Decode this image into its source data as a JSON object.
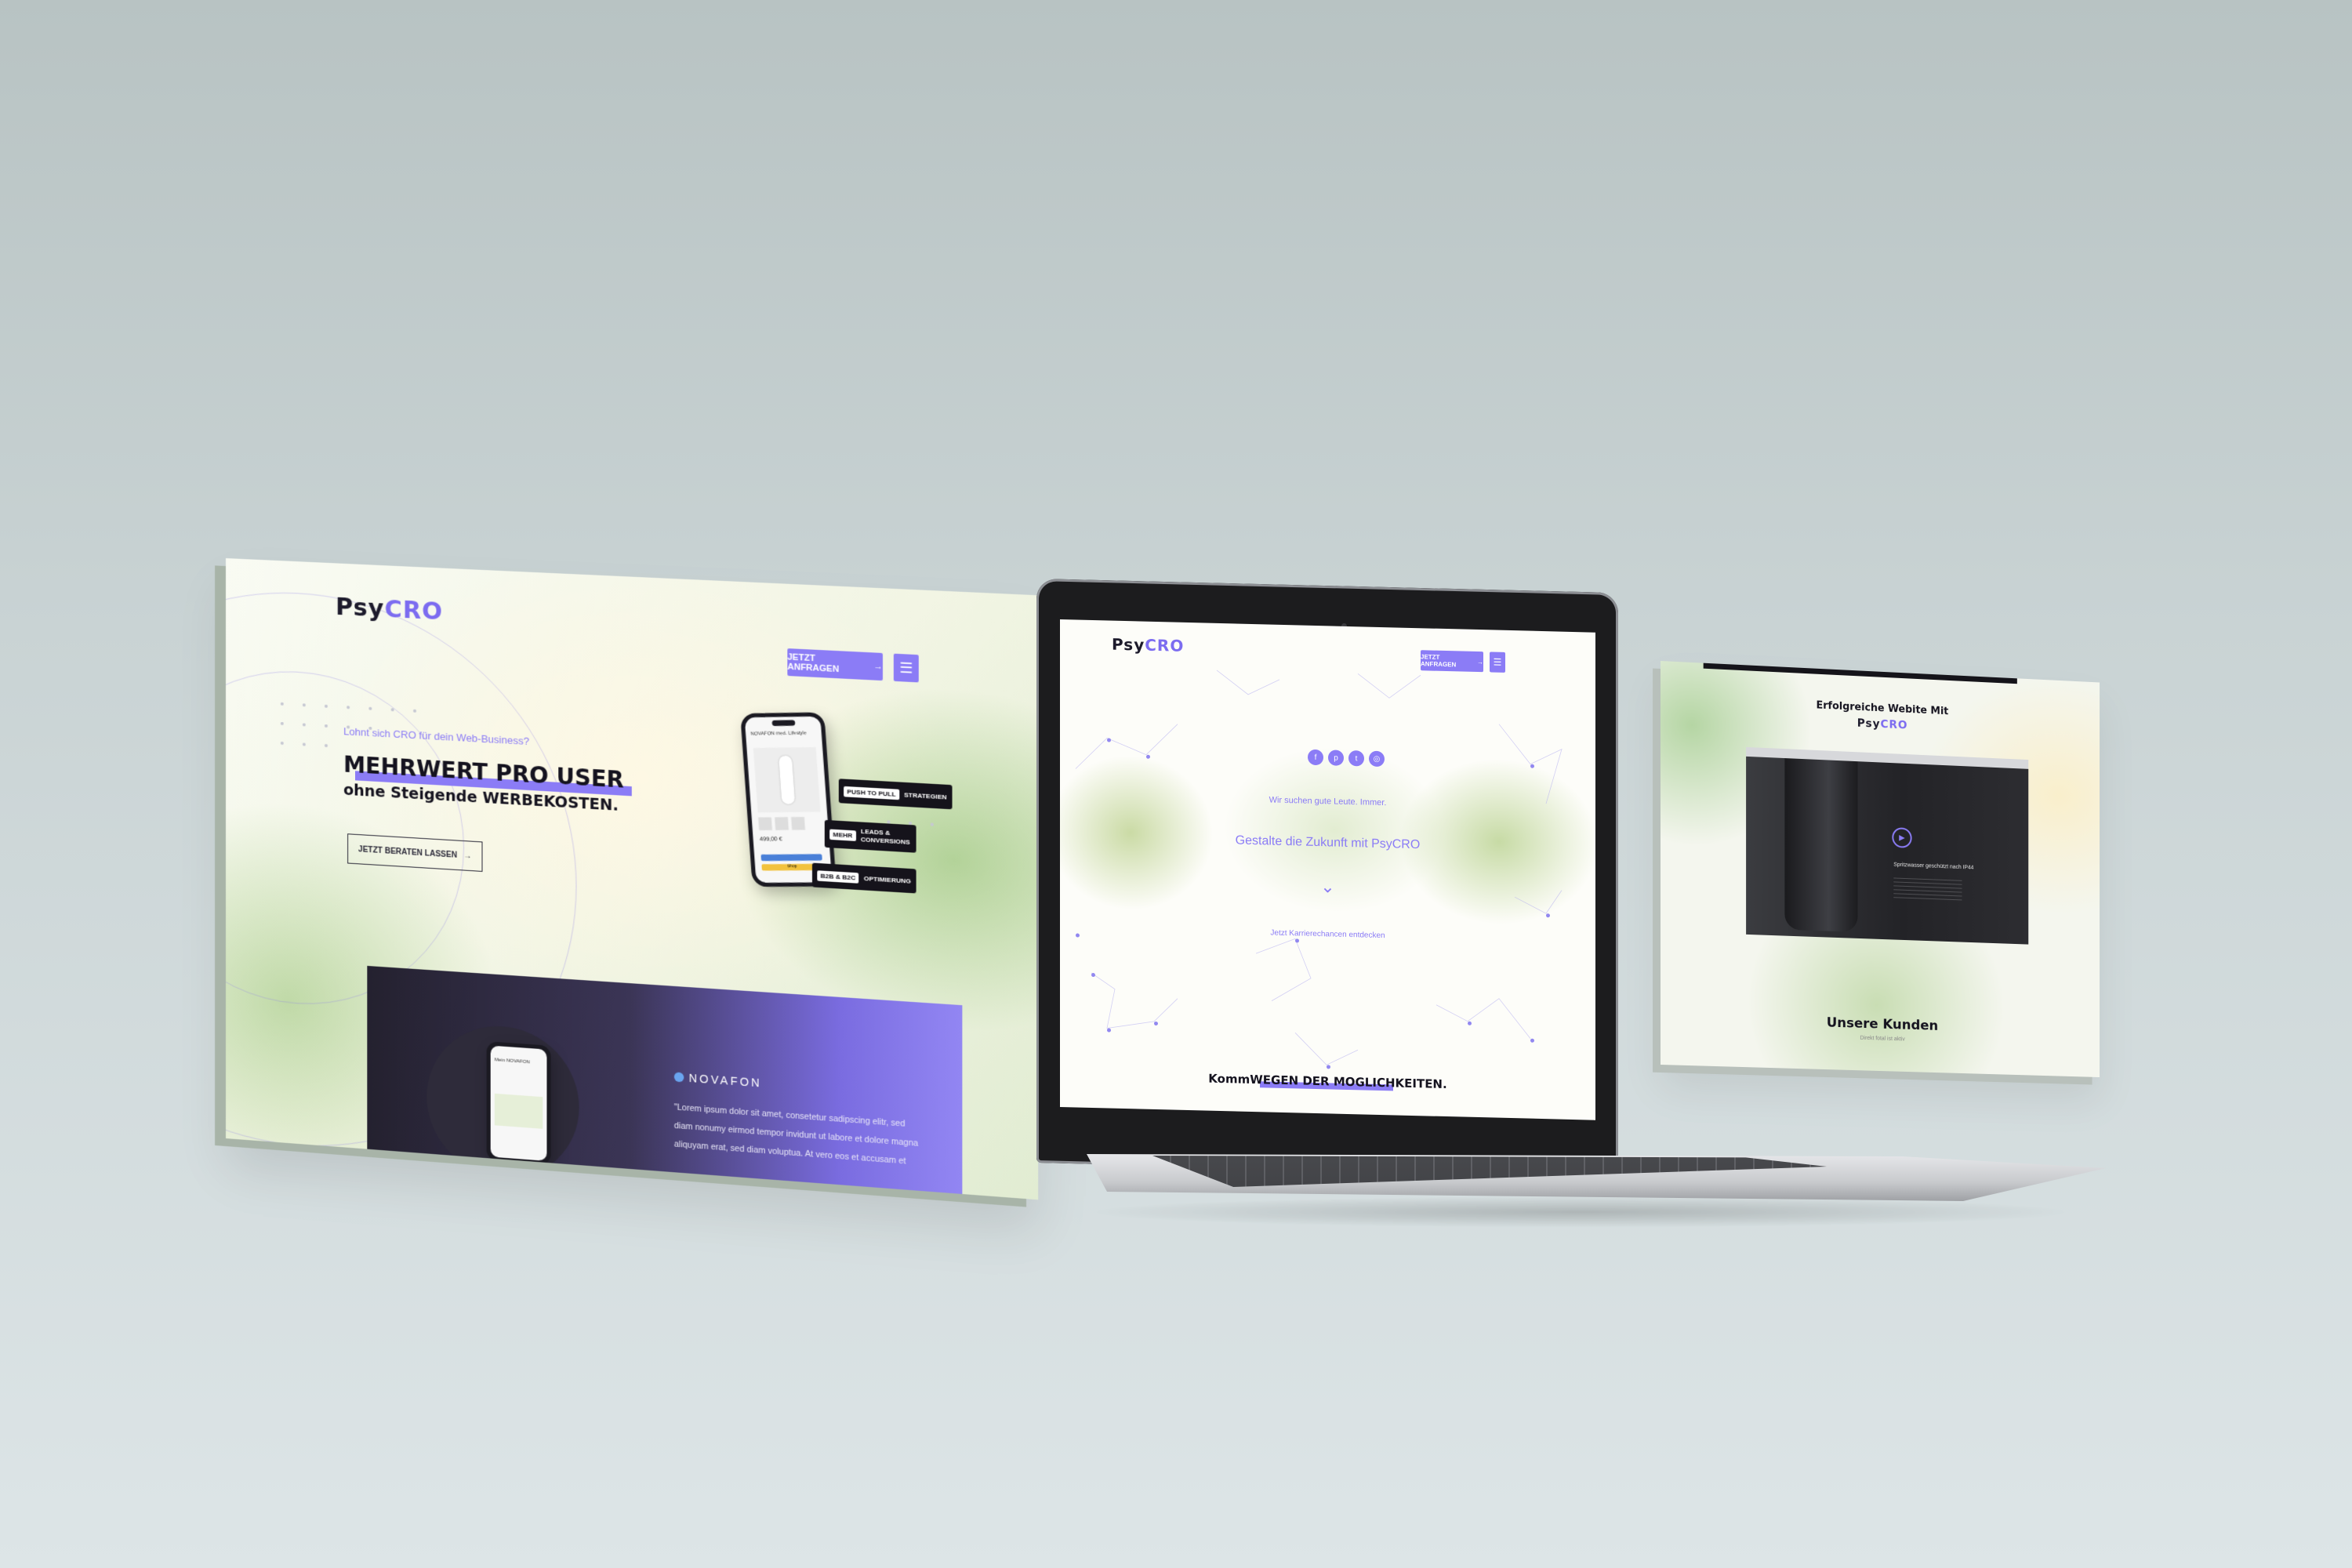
{
  "left_screen": {
    "logo_psy": "Psy",
    "logo_cro": "CRO",
    "cta_label": "JETZT ANFRAGEN",
    "menu_icon": "hamburger-icon",
    "eyebrow": "Lohnt sich CRO für dein Web-Business?",
    "headline": "MEHRWERT PRO USER",
    "subheadline": "ohne Steigende WERBEKOSTEN.",
    "consult_button": "JETZT BERATEN LASSEN",
    "phone_title": "NOVAFON med. Lifestyle",
    "phone_price": "499,00 €",
    "phone_shop_label": "Shop",
    "tags": [
      {
        "highlight": "PUSH TO PULL",
        "text": "STRATEGIEN"
      },
      {
        "highlight": "MEHR",
        "text": "LEADS & CONVERSIONS"
      },
      {
        "highlight": "B2B & B2C",
        "text": "OPTIMIERUNG"
      }
    ],
    "case": {
      "brand": "NOVAFON",
      "phone_heading": "Mein NOVAFON",
      "lorem_lines": [
        "\"Lorem ipsum dolor sit amet, consetetur sadipscing elitr, sed",
        "diam nonumy eirmod tempor invidunt ut labore et dolore magna",
        "aliquyam erat, sed diam voluptua. At vero eos et accusam et"
      ]
    }
  },
  "laptop": {
    "logo_psy": "Psy",
    "logo_cro": "CRO",
    "cta_label": "JETZT ANFRAGEN",
    "social_icons": [
      "facebook-icon",
      "pinterest-icon",
      "twitter-icon",
      "instagram-icon"
    ],
    "social_glyphs": [
      "f",
      "p",
      "t",
      "◎"
    ],
    "tagline": "Wir suchen gute Leute. Immer.",
    "headline": "Gestalte die Zukunft mit PsyCRO",
    "career_link": "Jetzt Karrierechancen entdecken",
    "bottom_prefix": "Komm",
    "bottom_highlight": "WEGEN DER MOGLICHKEITEN."
  },
  "right_screen": {
    "title": "Erfolgreiche Webite Mit",
    "logo_psy": "Psy",
    "logo_cro": "CRO",
    "mock_caption": "Spritzwasser geschützt nach IP44",
    "clients_title": "Unsere Kunden",
    "clients_sub": "Direkt fotal ist aktiv"
  },
  "colors": {
    "accent": "#8b7cf6",
    "dark": "#15131f",
    "background": "#c9d3d4"
  }
}
